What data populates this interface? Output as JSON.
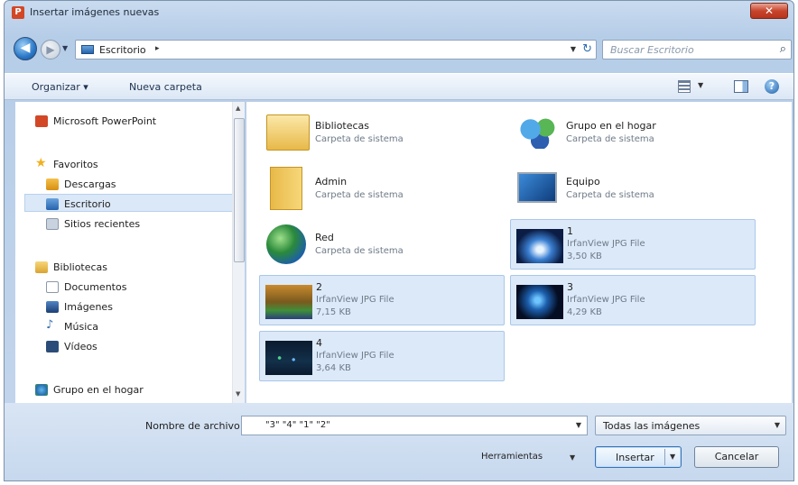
{
  "window": {
    "title": "Insertar imágenes nuevas",
    "app_icon": "P",
    "close_glyph": "✕"
  },
  "address": {
    "location": "Escritorio",
    "separator": "▸",
    "search_placeholder": "Buscar Escritorio"
  },
  "toolbar": {
    "organize_label": "Organizar ▾",
    "new_folder_label": "Nueva carpeta",
    "help": "?"
  },
  "nav": {
    "items": [
      {
        "label": "Microsoft PowerPoint",
        "icon": "powerpoint-icon"
      },
      {
        "label": "Favoritos",
        "icon": "star-icon"
      },
      {
        "label": "Descargas",
        "icon": "downloads-icon"
      },
      {
        "label": "Escritorio",
        "icon": "desktop-icon",
        "selected": true
      },
      {
        "label": "Sitios recientes",
        "icon": "recent-places-icon"
      },
      {
        "label": "Bibliotecas",
        "icon": "libraries-icon"
      },
      {
        "label": "Documentos",
        "icon": "documents-icon"
      },
      {
        "label": "Imágenes",
        "icon": "pictures-icon"
      },
      {
        "label": "Música",
        "icon": "music-icon"
      },
      {
        "label": "Vídeos",
        "icon": "videos-icon"
      },
      {
        "label": "Grupo en el hogar",
        "icon": "homegroup-icon"
      }
    ]
  },
  "files": [
    {
      "name": "Bibliotecas",
      "type": "Carpeta de sistema",
      "size": "",
      "selected": false
    },
    {
      "name": "Grupo en el hogar",
      "type": "Carpeta de sistema",
      "size": "",
      "selected": false
    },
    {
      "name": "Admin",
      "type": "Carpeta de sistema",
      "size": "",
      "selected": false
    },
    {
      "name": "Equipo",
      "type": "Carpeta de sistema",
      "size": "",
      "selected": false
    },
    {
      "name": "Red",
      "type": "Carpeta de sistema",
      "size": "",
      "selected": false
    },
    {
      "name": "1",
      "type": "IrfanView JPG File",
      "size": "3,50 KB",
      "selected": true
    },
    {
      "name": "2",
      "type": "IrfanView JPG File",
      "size": "7,15 KB",
      "selected": true
    },
    {
      "name": "3",
      "type": "IrfanView JPG File",
      "size": "4,29 KB",
      "selected": true
    },
    {
      "name": "4",
      "type": "IrfanView JPG File",
      "size": "3,64 KB",
      "selected": true
    }
  ],
  "footer": {
    "filename_label": "Nombre de archivo:",
    "filename_value": "\"3\" \"4\" \"1\" \"2\"",
    "filter_value": "Todas las imágenes",
    "tools_label": "Herramientas",
    "insert_label": "Insertar",
    "cancel_label": "Cancelar"
  },
  "colors": {
    "selection": "#dce9f8",
    "chrome": "#c4d6ec"
  }
}
